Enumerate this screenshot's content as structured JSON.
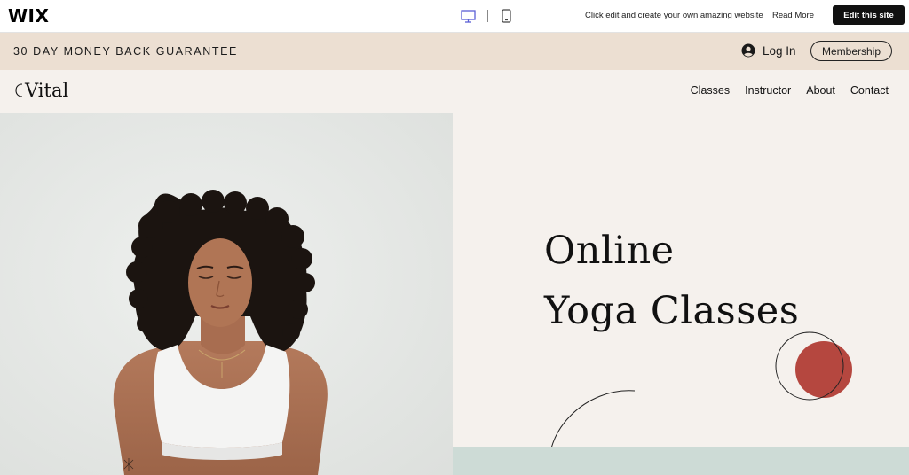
{
  "wix_bar": {
    "logo": "WIX",
    "promo_text": "Click edit and create your own amazing website",
    "read_more": "Read More",
    "edit_button": "Edit this site"
  },
  "announcement": {
    "text": "30 DAY MONEY BACK GUARANTEE",
    "login_label": "Log In",
    "membership_label": "Membership"
  },
  "site_header": {
    "brand": "Vital",
    "nav": [
      {
        "label": "Classes"
      },
      {
        "label": "Instructor"
      },
      {
        "label": "About"
      },
      {
        "label": "Contact"
      }
    ]
  },
  "hero": {
    "title_line1": "Online",
    "title_line2": "Yoga Classes",
    "image": "woman-meditating-photo"
  },
  "colors": {
    "announce_bg": "#ecdfd2",
    "header_bg": "#f5f1ed",
    "accent_circle": "#b5473f",
    "teal_band": "#cddbd6",
    "device_active": "#5a5fd6"
  }
}
